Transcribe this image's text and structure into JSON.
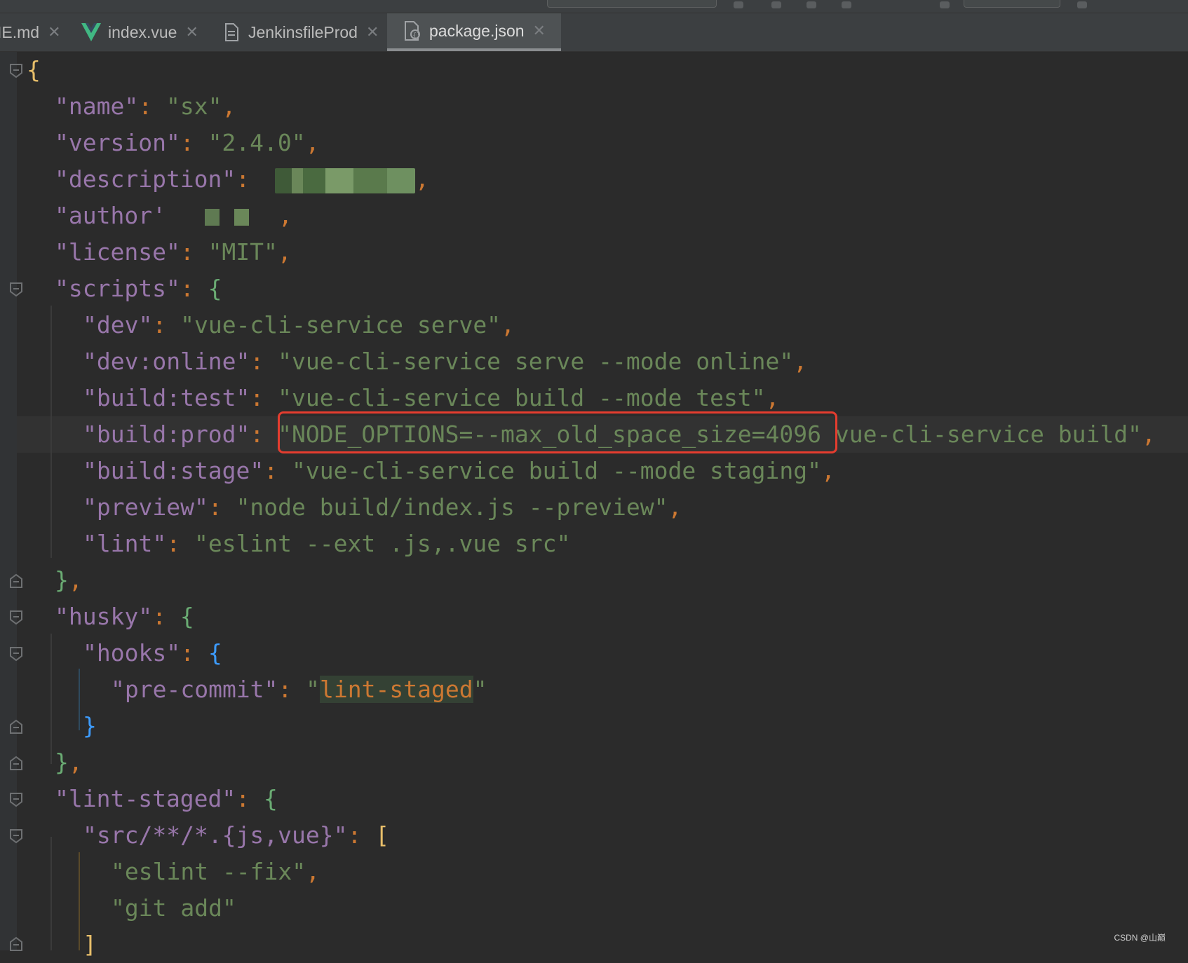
{
  "tabs": [
    {
      "label": "IE.md",
      "icon": "markdown-file-icon",
      "active": false
    },
    {
      "label": "index.vue",
      "icon": "vue-logo-icon",
      "active": false
    },
    {
      "label": "JenkinsfileProd",
      "icon": "text-file-icon",
      "active": false
    },
    {
      "label": "package.json",
      "icon": "json-config-file-icon",
      "active": true
    }
  ],
  "code": {
    "name_key": "\"name\"",
    "name_val": "\"sx\"",
    "version_key": "\"version\"",
    "version_val": "\"2.4.0\"",
    "description_key": "\"description\"",
    "author_key": "\"author'",
    "license_key": "\"license\"",
    "license_val": "\"MIT\"",
    "scripts_key": "\"scripts\"",
    "dev_key": "\"dev\"",
    "dev_val": "\"vue-cli-service serve\"",
    "devonline_key": "\"dev:online\"",
    "devonline_val": "\"vue-cli-service serve --mode online\"",
    "buildtest_key": "\"build:test\"",
    "buildtest_val": "\"vue-cli-service build --mode test\"",
    "buildprod_key": "\"build:prod\"",
    "buildprod_val_a": "\"NODE_OPTIONS=--max_old_space_size=4096",
    "buildprod_val_b": " vue-cli-service build\"",
    "buildstage_key": "\"build:stage\"",
    "buildstage_val": "\"vue-cli-service build --mode staging\"",
    "preview_key": "\"preview\"",
    "preview_val": "\"node build/index.js --preview\"",
    "lint_key": "\"lint\"",
    "lint_val": "\"eslint --ext .js,.vue src\"",
    "husky_key": "\"husky\"",
    "hooks_key": "\"hooks\"",
    "precommit_key": "\"pre-commit\"",
    "precommit_q1": "\"",
    "precommit_val": "lint-staged",
    "precommit_q2": "\"",
    "lintstaged_key": "\"lint-staged\"",
    "glob_key": "\"src/**/*.{js,vue}\"",
    "eslintfix_val": "\"eslint --fix\"",
    "gitadd_val": "\"git add\""
  },
  "watermark": "CSDN @山巅",
  "colors": {
    "highlight_box": "#e53d2f",
    "key": "#9876aa",
    "string": "#6a8759",
    "punct": "#cc7832"
  }
}
